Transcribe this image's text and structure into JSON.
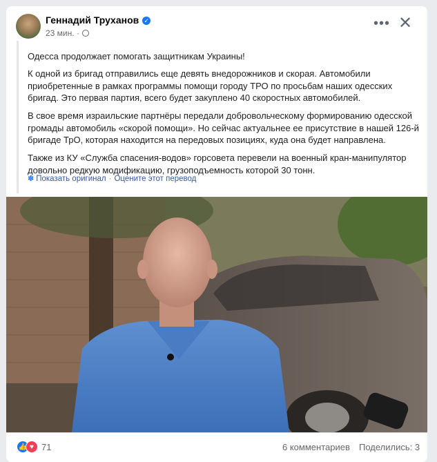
{
  "post": {
    "author": "Геннадий Труханов",
    "time": "23 мин.",
    "paragraphs": [
      "Одесса продолжает помогать защитникам Украины!",
      "К одной из бригад отправились еще девять внедорожников и скорая. Автомобили приобретенные в рамках программы помощи городу ТРО по просьбам наших одесских бригад. Это первая партия, всего будет закуплено 40 скоростных автомобилей.",
      "В свое время израильские партнёры передали добровольческому формированию одесской громады автомобиль «скорой помощи». Но сейчас актуальнее ее присутствие в нашей 126-й бригаде ТрО, которая находится на передовых позициях, куда она будет направлена.",
      "Также из КУ «Служба спасения-водов» горсовета перевели на военный кран-манипулятор довольно редкую модификацию, грузоподъемность которой 30 тонн."
    ],
    "show_original": "Показать оригинал",
    "rate_translation": "Оцените этот перевод"
  },
  "footer": {
    "reactions_count": "71",
    "comments": "6 комментариев",
    "shares": "Поделились: 3"
  },
  "colors": {
    "accent": "#1877f2",
    "love": "#f33e58",
    "link": "#385898"
  },
  "icons": [
    "verified-badge-icon",
    "globe-icon",
    "more-icon",
    "close-icon",
    "gear-icon",
    "like-icon",
    "love-icon"
  ]
}
